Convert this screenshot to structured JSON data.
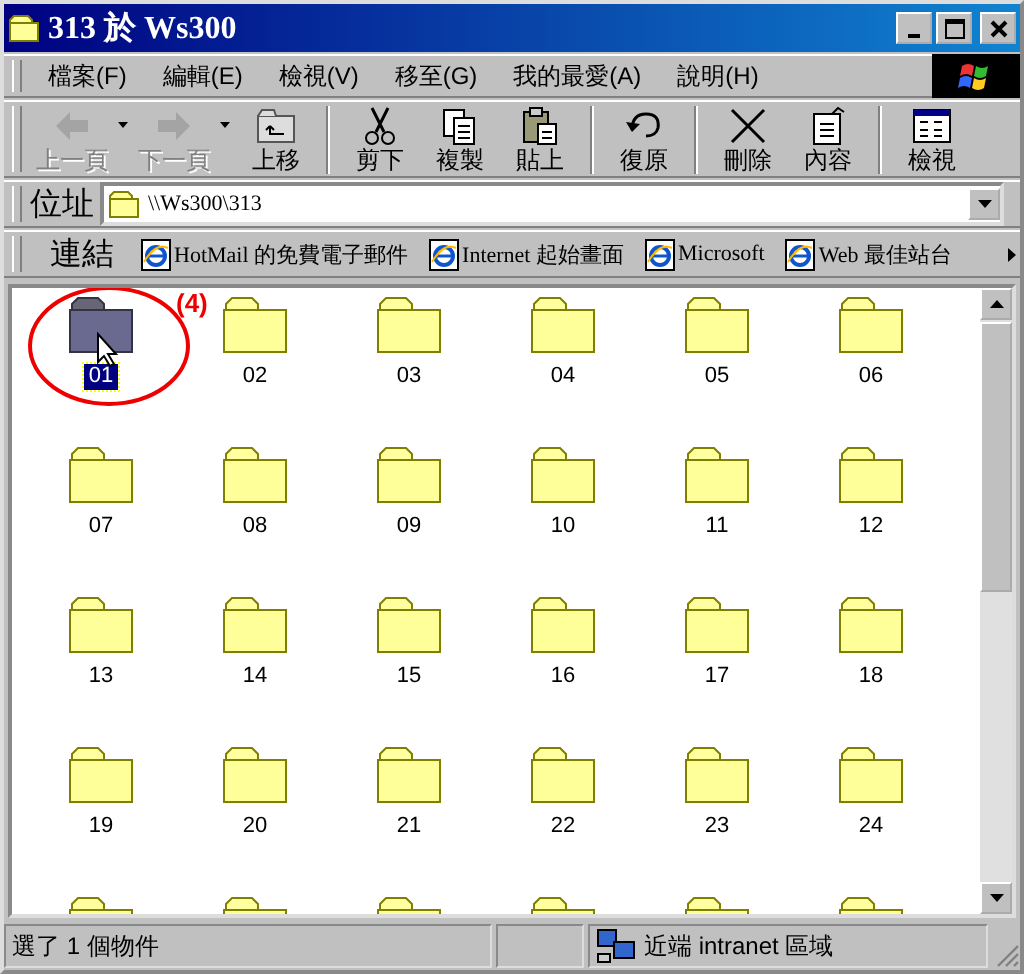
{
  "window": {
    "title": "313 於 Ws300",
    "controls": [
      {
        "kind": "minimize"
      },
      {
        "kind": "maximize"
      },
      {
        "kind": "close"
      }
    ]
  },
  "menu": [
    "檔案(F)",
    "編輯(E)",
    "檢視(V)",
    "移至(G)",
    "我的最愛(A)",
    "說明(H)"
  ],
  "toolbar": [
    {
      "kind": "back",
      "label": "上一頁",
      "disabled": true,
      "dropdown": true
    },
    {
      "kind": "forward",
      "label": "下一頁",
      "disabled": true,
      "dropdown": true
    },
    {
      "kind": "up",
      "label": "上移",
      "disabled": false,
      "dropdown": false
    },
    {
      "kind": "separator"
    },
    {
      "kind": "cut",
      "label": "剪下",
      "disabled": false,
      "dropdown": false
    },
    {
      "kind": "copy",
      "label": "複製",
      "disabled": false,
      "dropdown": false
    },
    {
      "kind": "paste",
      "label": "貼上",
      "disabled": false,
      "dropdown": false
    },
    {
      "kind": "separator"
    },
    {
      "kind": "undo",
      "label": "復原",
      "disabled": false,
      "dropdown": false
    },
    {
      "kind": "separator"
    },
    {
      "kind": "delete",
      "label": "刪除",
      "disabled": false,
      "dropdown": false
    },
    {
      "kind": "properties",
      "label": "內容",
      "disabled": false,
      "dropdown": false
    },
    {
      "kind": "separator"
    },
    {
      "kind": "views",
      "label": "檢視",
      "disabled": false,
      "dropdown": false
    }
  ],
  "address": {
    "label": "位址",
    "value": "\\\\Ws300\\313"
  },
  "links": {
    "label": "連結",
    "items": [
      "HotMail 的免費電子郵件",
      "Internet 起始畫面",
      "Microsoft",
      "Web 最佳站台"
    ]
  },
  "folders": [
    {
      "label": "01",
      "selected": true
    },
    {
      "label": "02",
      "selected": false
    },
    {
      "label": "03",
      "selected": false
    },
    {
      "label": "04",
      "selected": false
    },
    {
      "label": "05",
      "selected": false
    },
    {
      "label": "06",
      "selected": false
    },
    {
      "label": "07",
      "selected": false
    },
    {
      "label": "08",
      "selected": false
    },
    {
      "label": "09",
      "selected": false
    },
    {
      "label": "10",
      "selected": false
    },
    {
      "label": "11",
      "selected": false
    },
    {
      "label": "12",
      "selected": false
    },
    {
      "label": "13",
      "selected": false
    },
    {
      "label": "14",
      "selected": false
    },
    {
      "label": "15",
      "selected": false
    },
    {
      "label": "16",
      "selected": false
    },
    {
      "label": "17",
      "selected": false
    },
    {
      "label": "18",
      "selected": false
    },
    {
      "label": "19",
      "selected": false
    },
    {
      "label": "20",
      "selected": false
    },
    {
      "label": "21",
      "selected": false
    },
    {
      "label": "22",
      "selected": false
    },
    {
      "label": "23",
      "selected": false
    },
    {
      "label": "24",
      "selected": false
    }
  ],
  "cut_off_folders": [
    {
      "kind": "folder"
    },
    {
      "kind": "folder"
    },
    {
      "kind": "folder"
    },
    {
      "kind": "folder"
    },
    {
      "kind": "folder"
    },
    {
      "kind": "folder"
    }
  ],
  "annotation": {
    "text": "(4)"
  },
  "status_bar": {
    "text": "選了 1 個物件",
    "zone": "近端 intranet 區域"
  }
}
